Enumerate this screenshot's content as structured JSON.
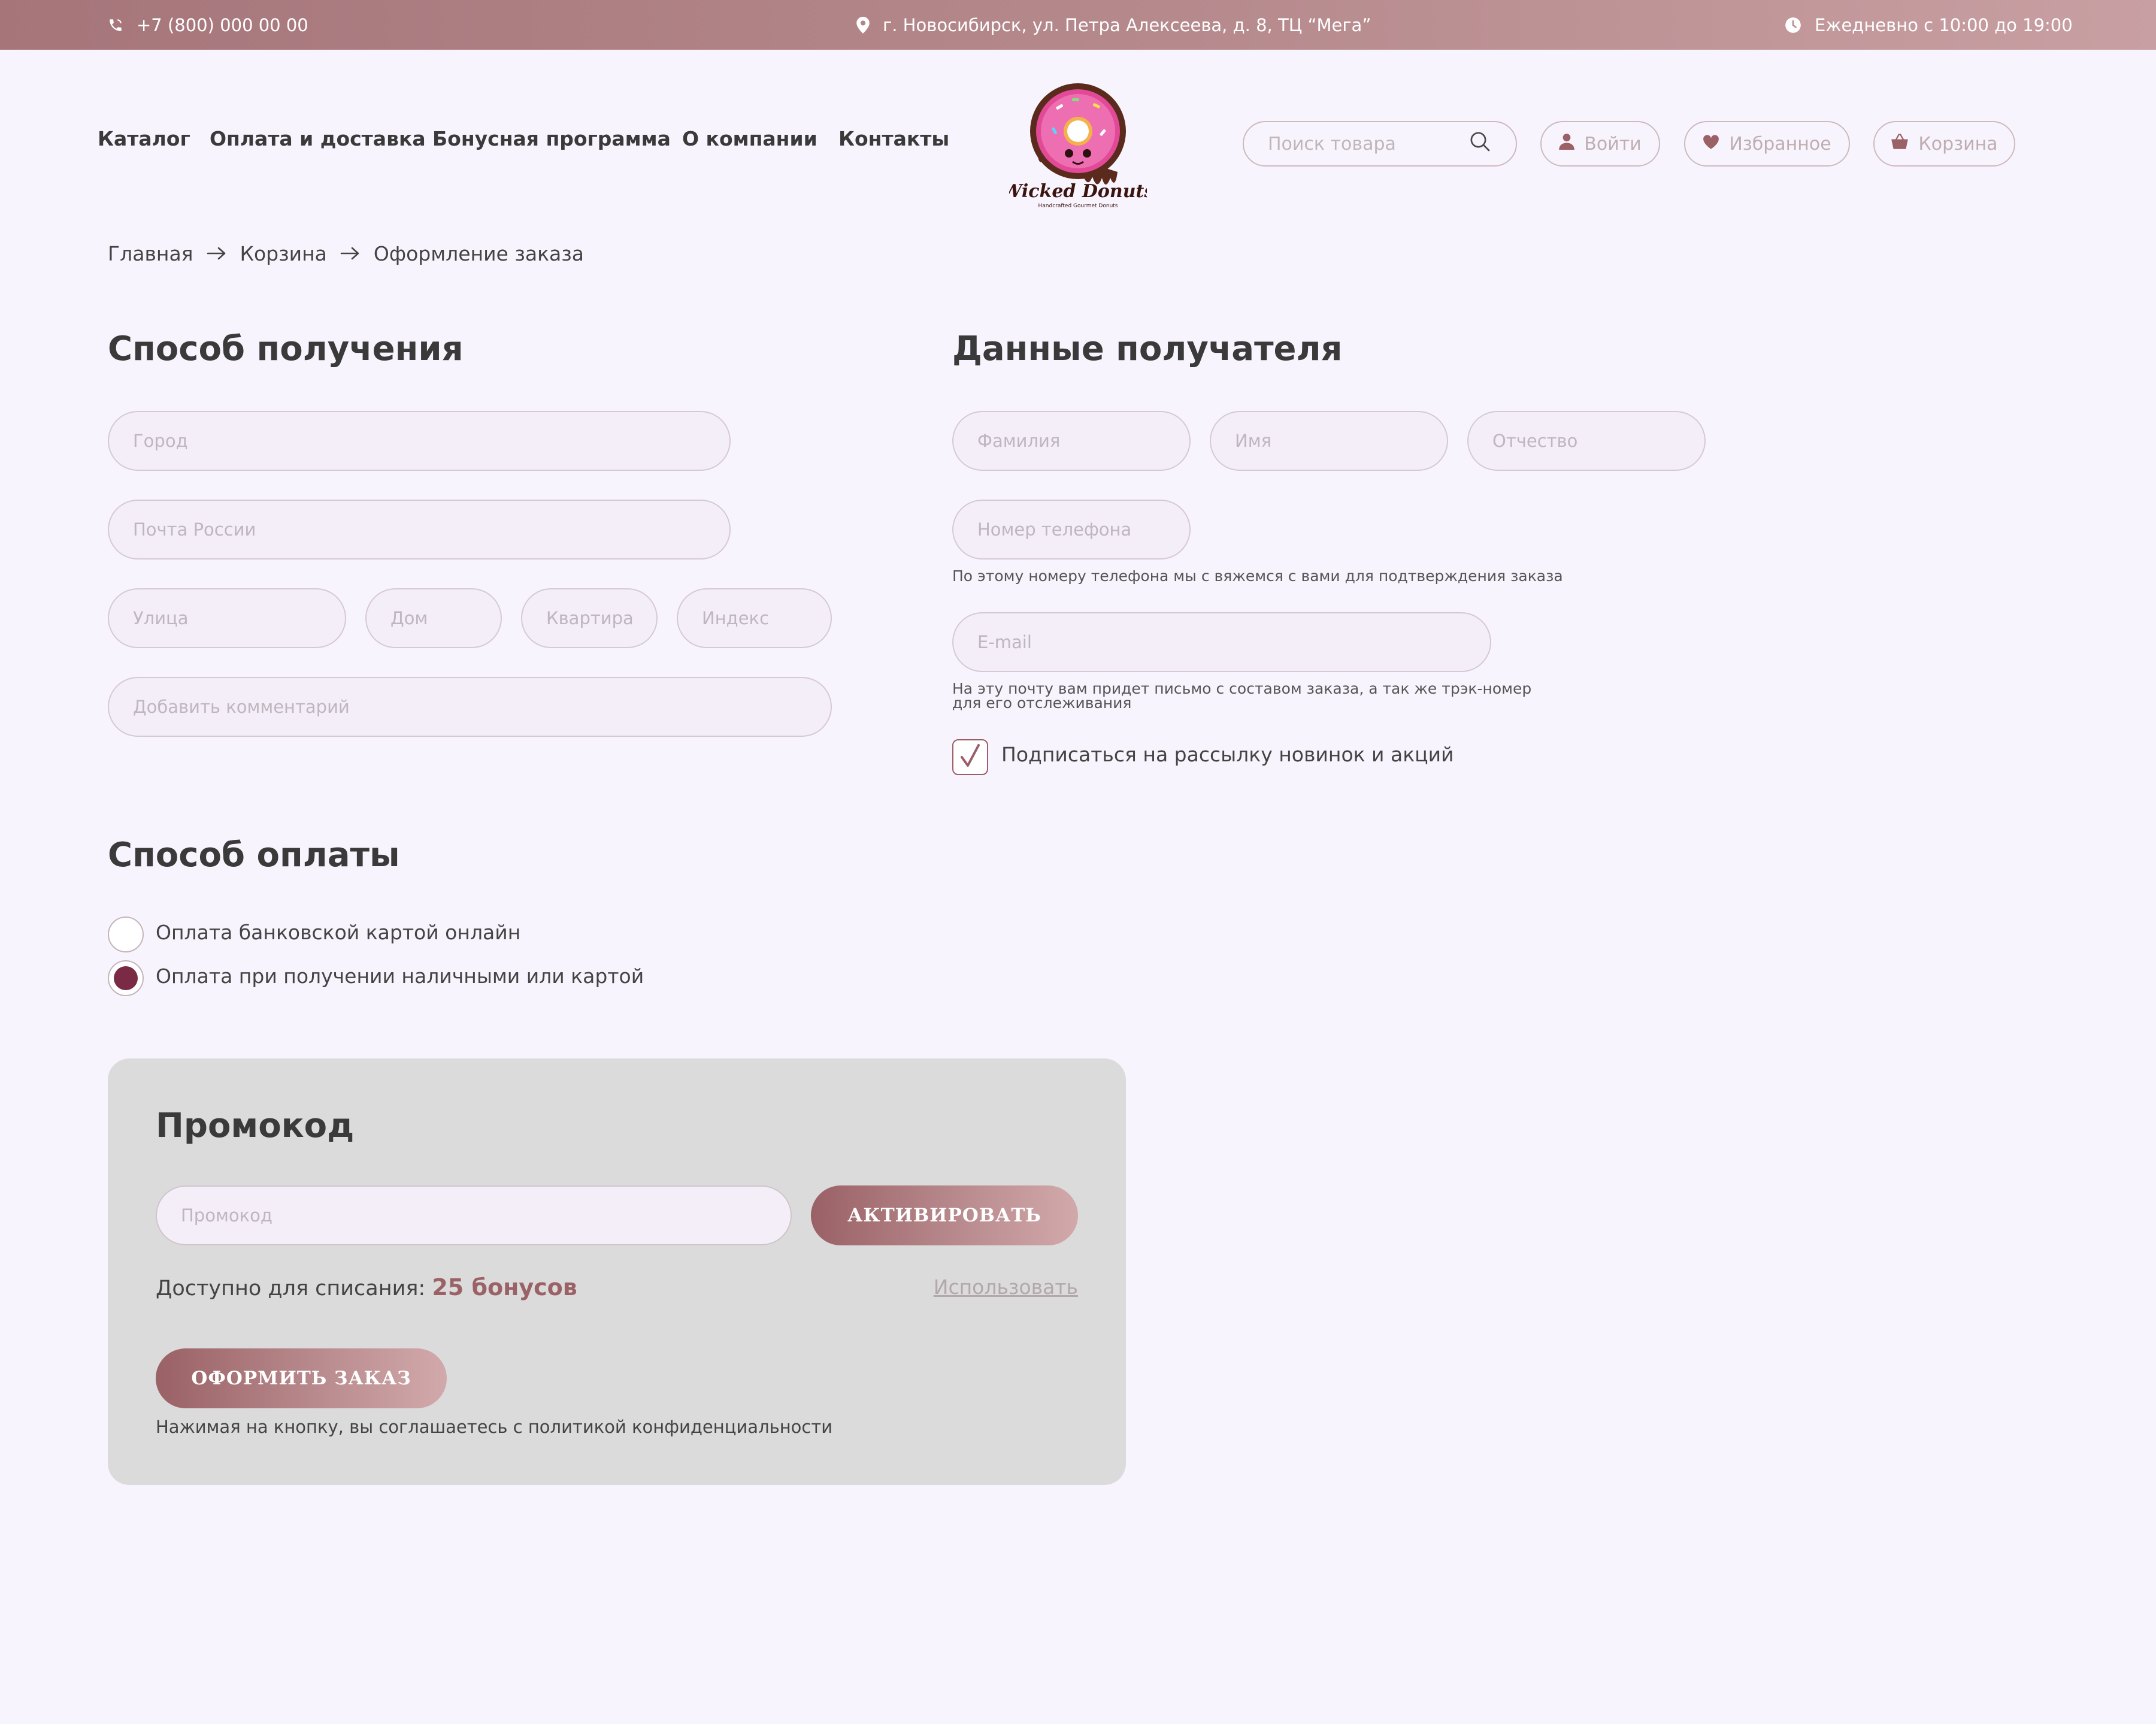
{
  "colors": {
    "accent": "#9a6166",
    "topbar_start": "#a5757a",
    "topbar_end": "#c89fa2",
    "background": "#f8f4fd",
    "radio_selected": "#7a2a44",
    "card_background": "#dbdbdb"
  },
  "topbar": {
    "phone": "+7 (800) 000 00 00",
    "address": "г. Новосибирск, ул. Петра Алексеева, д. 8, ТЦ “Мега”",
    "hours": "Ежедневно с 10:00 до 19:00",
    "icons": [
      "phone-icon",
      "location-pin-icon",
      "clock-icon"
    ]
  },
  "nav": {
    "items": [
      "Каталог",
      "Оплата и доставка",
      "Бонусная программа",
      "О компании",
      "Контакты"
    ]
  },
  "logo": {
    "name": "Wicked Donuts",
    "tagline": "Handcrafted Gourmet Donuts"
  },
  "header_actions": {
    "search_placeholder": "Поиск товара",
    "login": "Войти",
    "favorites": "Избранное",
    "cart": "Корзина",
    "icons": [
      "search-icon",
      "user-icon",
      "heart-icon",
      "basket-icon"
    ]
  },
  "breadcrumb": [
    "Главная",
    "Корзина",
    "Оформление заказа"
  ],
  "delivery": {
    "title": "Способ получения",
    "city_placeholder": "Город",
    "service_placeholder": "Почта России",
    "street_placeholder": "Улица",
    "house_placeholder": "Дом",
    "apartment_placeholder": "Квартира",
    "index_placeholder": "Индекс",
    "comment_placeholder": "Добавить комментарий"
  },
  "recipient": {
    "title": "Данные получателя",
    "lastname_placeholder": "Фамилия",
    "firstname_placeholder": "Имя",
    "patronymic_placeholder": "Отчество",
    "phone_placeholder": "Номер телефона",
    "phone_hint": "По этому номеру телефона мы с вяжемся с вами для подтверждения заказа",
    "email_placeholder": "E-mail",
    "email_hint_line1": "На эту почту вам придет письмо с составом заказа, а так же трэк-номер",
    "email_hint_line2": "для его отслеживания",
    "subscribe_label": "Подписаться на рассылку новинок и акций",
    "subscribe_checked": true
  },
  "payment": {
    "title": "Способ оплаты",
    "options": [
      {
        "label": "Оплата банковской картой онлайн",
        "selected": false
      },
      {
        "label": "Оплата при получении наличными или картой",
        "selected": true
      }
    ]
  },
  "promo": {
    "title": "Промокод",
    "input_placeholder": "Промокод",
    "activate_label": "АКТИВИРОВАТЬ",
    "available_label": "Доступно для списания:",
    "available_value": "25 бонусов",
    "use_link": "Использовать",
    "submit_label": "ОФОРМИТЬ ЗАКАЗ",
    "agreement": "Нажимая на кнопку, вы соглашаетесь с политикой конфиденциальности"
  }
}
